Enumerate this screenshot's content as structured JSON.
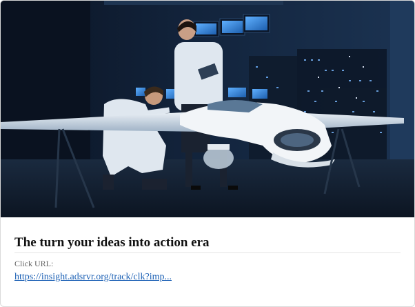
{
  "ad": {
    "image_alt": "Engineers examining a drone model in a server room lab",
    "title": "The turn your ideas into action era",
    "url_label": "Click URL:",
    "url_text": "https://insight.adsrvr.org/track/clk?imp..."
  },
  "colors": {
    "link": "#1a5fb4",
    "title": "#111111",
    "label": "#666666"
  }
}
